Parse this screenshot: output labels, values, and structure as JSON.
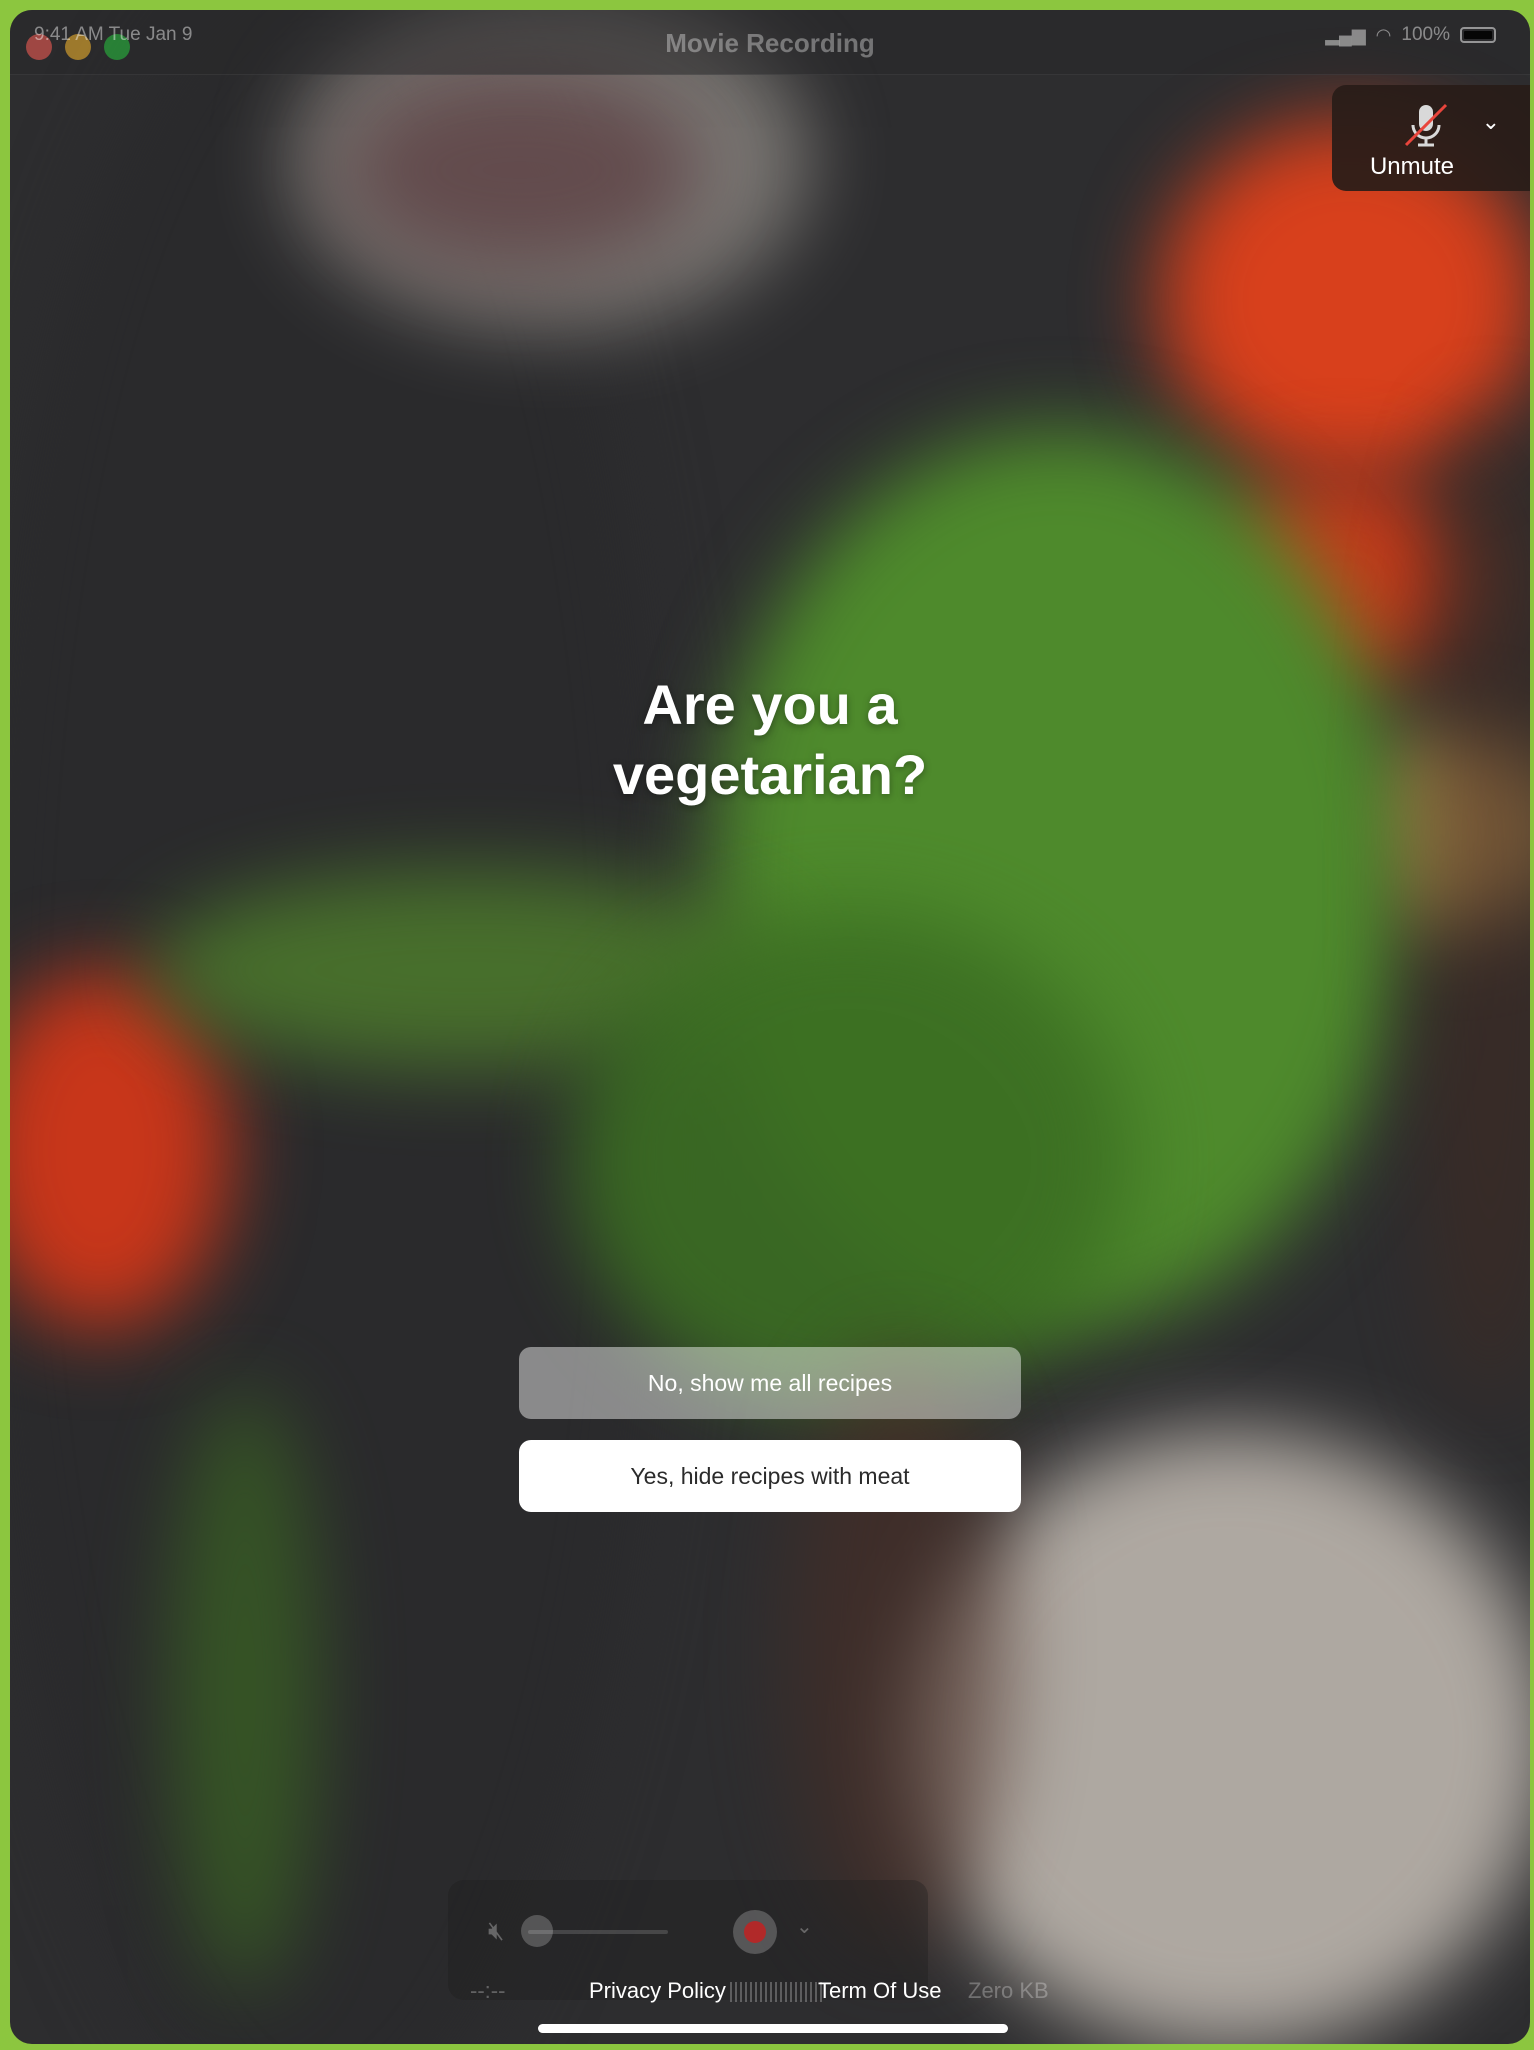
{
  "window": {
    "title": "Movie Recording"
  },
  "status_bar": {
    "time": "9:41 AM  Tue Jan 9",
    "battery": "100%"
  },
  "unmute": {
    "label": "Unmute"
  },
  "question": {
    "line1": "Are you a",
    "line2": "vegetarian?"
  },
  "options": {
    "no": "No, show me all recipes",
    "yes": "Yes, hide recipes with meat"
  },
  "recorder": {
    "time": "--:--",
    "privacy": "Privacy Policy",
    "terms": "Term Of Use",
    "size": "Zero KB"
  },
  "colors": {
    "frame": "#8cc63f",
    "button_primary": "#ffffff"
  },
  "icons": [
    "mic-muted-icon",
    "chevron-down-icon",
    "speaker-muted-icon",
    "record-icon",
    "battery-icon",
    "wifi-icon",
    "signal-icon"
  ]
}
